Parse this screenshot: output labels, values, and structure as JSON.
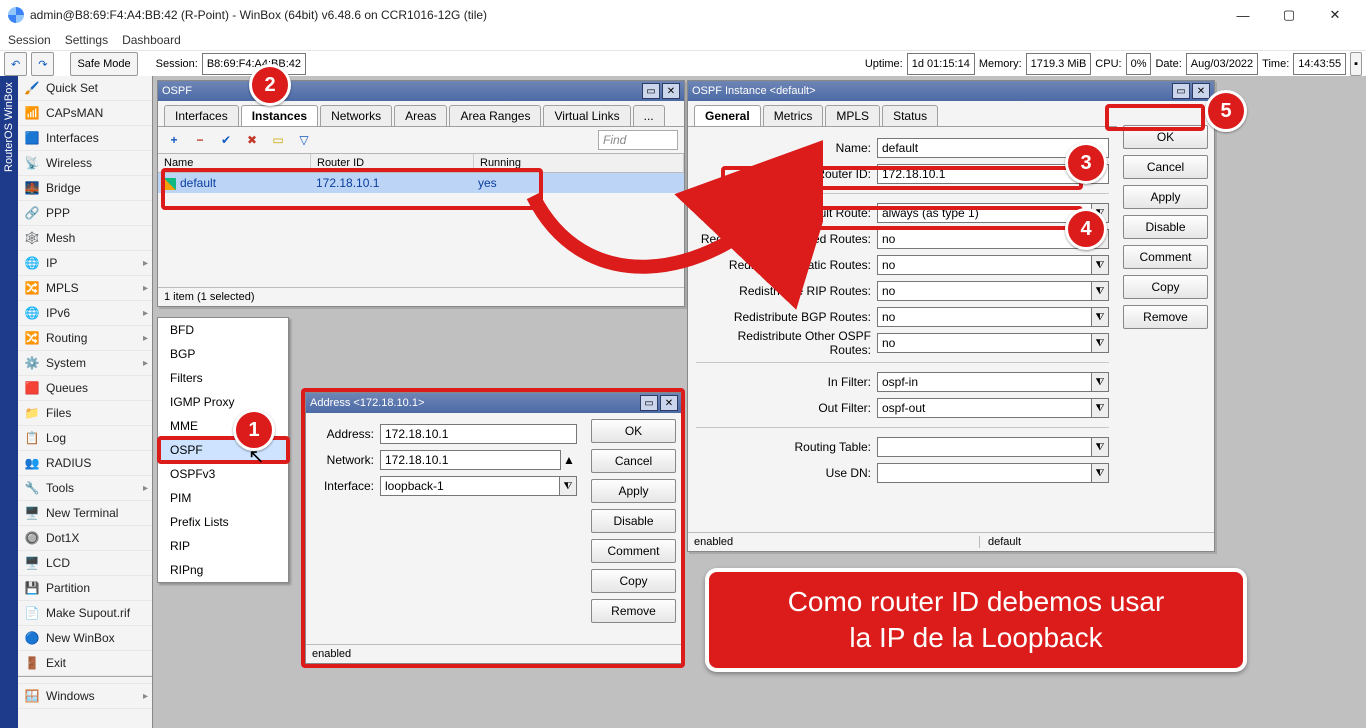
{
  "title": "admin@B8:69:F4:A4:BB:42 (R-Point) - WinBox (64bit) v6.48.6 on CCR1016-12G (tile)",
  "menubar": [
    "Session",
    "Settings",
    "Dashboard"
  ],
  "toolbar": {
    "safe_mode": "Safe Mode",
    "session_lbl": "Session:",
    "session_val": "B8:69:F4:A4:BB:42",
    "uptime_lbl": "Uptime:",
    "uptime_val": "1d 01:15:14",
    "mem_lbl": "Memory:",
    "mem_val": "1719.3 MiB",
    "cpu_lbl": "CPU:",
    "cpu_val": "0%",
    "date_lbl": "Date:",
    "date_val": "Aug/03/2022",
    "time_lbl": "Time:",
    "time_val": "14:43:55"
  },
  "vbar": "RouterOS WinBox",
  "sidebar": [
    {
      "icon": "🖌️",
      "label": "Quick Set"
    },
    {
      "icon": "📶",
      "label": "CAPsMAN"
    },
    {
      "icon": "🟦",
      "label": "Interfaces"
    },
    {
      "icon": "📡",
      "label": "Wireless"
    },
    {
      "icon": "🌉",
      "label": "Bridge"
    },
    {
      "icon": "🔗",
      "label": "PPP"
    },
    {
      "icon": "🕸️",
      "label": "Mesh"
    },
    {
      "icon": "🌐",
      "label": "IP",
      "sub": true
    },
    {
      "icon": "🔀",
      "label": "MPLS",
      "sub": true
    },
    {
      "icon": "🌐",
      "label": "IPv6",
      "sub": true
    },
    {
      "icon": "🔀",
      "label": "Routing",
      "sub": true
    },
    {
      "icon": "⚙️",
      "label": "System",
      "sub": true
    },
    {
      "icon": "🟥",
      "label": "Queues"
    },
    {
      "icon": "📁",
      "label": "Files"
    },
    {
      "icon": "📋",
      "label": "Log"
    },
    {
      "icon": "👥",
      "label": "RADIUS"
    },
    {
      "icon": "🔧",
      "label": "Tools",
      "sub": true
    },
    {
      "icon": "🖥️",
      "label": "New Terminal"
    },
    {
      "icon": "🔘",
      "label": "Dot1X"
    },
    {
      "icon": "🖥️",
      "label": "LCD"
    },
    {
      "icon": "💾",
      "label": "Partition"
    },
    {
      "icon": "📄",
      "label": "Make Supout.rif"
    },
    {
      "icon": "🔵",
      "label": "New WinBox"
    },
    {
      "icon": "🚪",
      "label": "Exit"
    },
    {
      "icon": "",
      "label": ""
    },
    {
      "icon": "🪟",
      "label": "Windows",
      "sub": true
    }
  ],
  "submenu": [
    "BFD",
    "BGP",
    "Filters",
    "IGMP Proxy",
    "MME",
    "OSPF",
    "OSPFv3",
    "PIM",
    "Prefix Lists",
    "RIP",
    "RIPng"
  ],
  "ospf": {
    "title": "OSPF",
    "tabs": [
      "Interfaces",
      "Instances",
      "Networks",
      "Areas",
      "Area Ranges",
      "Virtual Links",
      "..."
    ],
    "active_tab": 1,
    "find": "Find",
    "cols": {
      "name": "Name",
      "rid": "Router ID",
      "running": "Running"
    },
    "row": {
      "name": "default",
      "rid": "172.18.10.1",
      "running": "yes"
    },
    "status": "1 item (1 selected)"
  },
  "addr": {
    "title": "Address <172.18.10.1>",
    "address_lbl": "Address:",
    "address": "172.18.10.1",
    "network_lbl": "Network:",
    "network": "172.18.10.1",
    "iface_lbl": "Interface:",
    "iface": "loopback-1",
    "btns": [
      "OK",
      "Cancel",
      "Apply",
      "Disable",
      "Comment",
      "Copy",
      "Remove"
    ],
    "status": "enabled"
  },
  "inst": {
    "title": "OSPF Instance <default>",
    "tabs": [
      "General",
      "Metrics",
      "MPLS",
      "Status"
    ],
    "active_tab": 0,
    "name_lbl": "Name:",
    "name": "default",
    "rid_lbl": "Router ID:",
    "rid": "172.18.10.1",
    "rdef_lbl": "Redistribute Default Route:",
    "rdef": "always (as type 1)",
    "rcon_lbl": "Redistribute Connected Routes:",
    "rcon": "no",
    "rsta_lbl": "Redistribute Static Routes:",
    "rsta": "no",
    "rrip_lbl": "Redistribute RIP Routes:",
    "rrip": "no",
    "rbgp_lbl": "Redistribute BGP Routes:",
    "rbgp": "no",
    "roth_lbl": "Redistribute Other OSPF Routes:",
    "roth": "no",
    "inf_lbl": "In Filter:",
    "inf": "ospf-in",
    "outf_lbl": "Out Filter:",
    "outf": "ospf-out",
    "rt_lbl": "Routing Table:",
    "rt": "",
    "dn_lbl": "Use DN:",
    "dn": "",
    "btns": [
      "OK",
      "Cancel",
      "Apply",
      "Disable",
      "Comment",
      "Copy",
      "Remove"
    ],
    "status_l": "enabled",
    "status_r": "default"
  },
  "ann": {
    "b1": "1",
    "b2": "2",
    "b3": "3",
    "b4": "4",
    "b5": "5",
    "callout_l1": "Como router ID debemos usar",
    "callout_l2": "la IP de la Loopback"
  }
}
